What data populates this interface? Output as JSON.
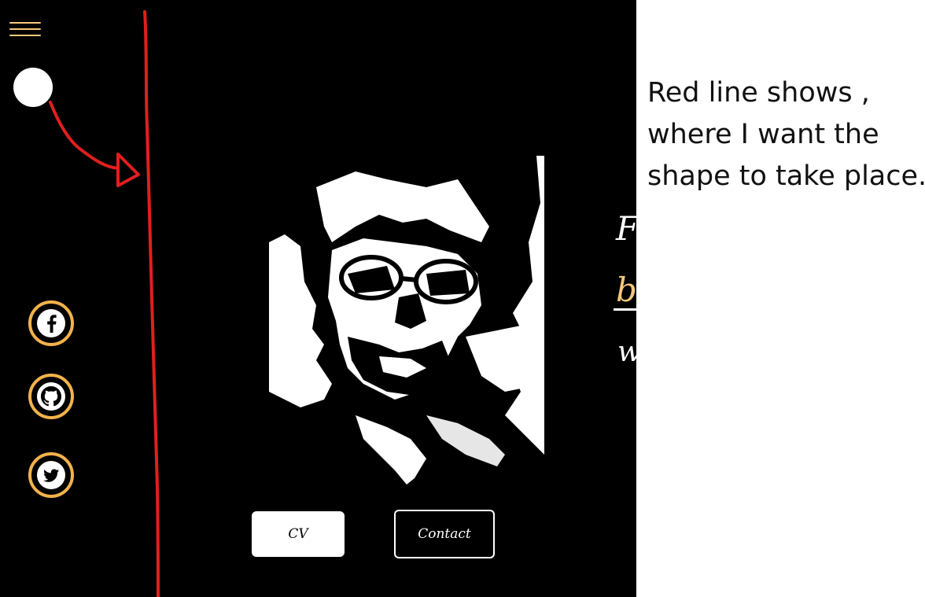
{
  "nav": {
    "menu_icon": "hamburger-menu-icon",
    "menu_color": "#f6c87a"
  },
  "social": [
    {
      "name": "facebook",
      "icon": "facebook-icon",
      "color": "#f3b24a"
    },
    {
      "name": "github",
      "icon": "github-icon",
      "color": "#f3b24a"
    },
    {
      "name": "twitter",
      "icon": "twitter-icon",
      "color": "#f3b24a"
    }
  ],
  "hero": {
    "photo_icon": "portrait-photo",
    "heading_fragments": [
      "F",
      "b",
      "w"
    ],
    "accent_color": "#f6c87a"
  },
  "buttons": {
    "cv_label": "CV",
    "contact_label": "Contact"
  },
  "annotation": {
    "line_color": "#e0201e",
    "note_lines": [
      "Red line shows ,",
      "where I want the",
      "shape to take place."
    ]
  }
}
